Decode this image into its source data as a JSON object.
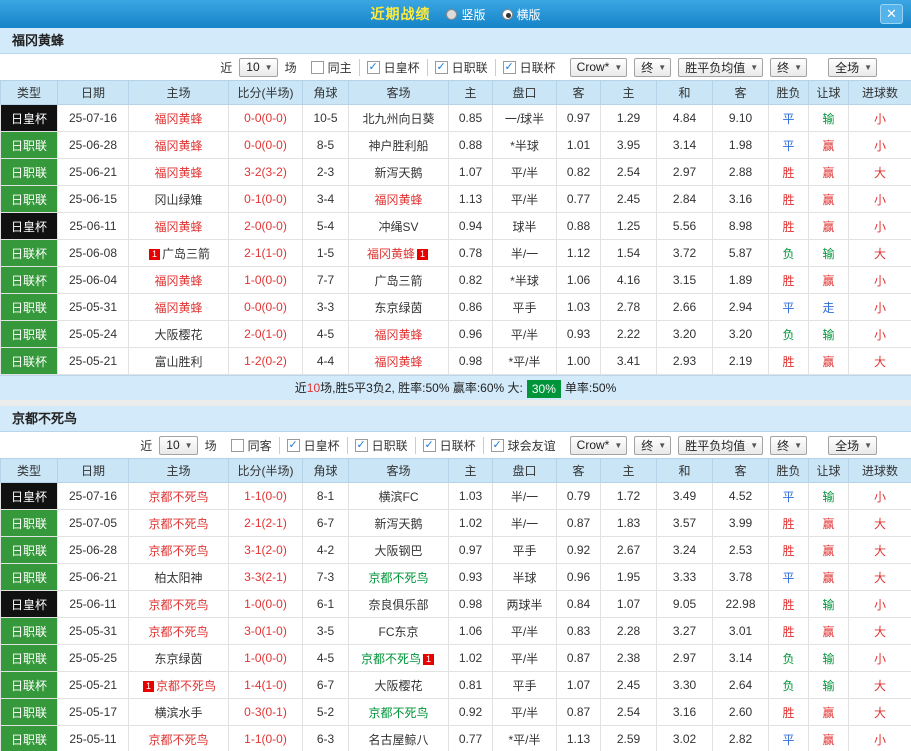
{
  "titlebar": {
    "title": "近期战绩",
    "layout_vertical": "竖版",
    "layout_horizontal": "横版",
    "close_icon": "✕"
  },
  "controls": {
    "near": "近",
    "count": "10",
    "unit": "场",
    "book": "Crow*",
    "final_a": "终",
    "avg": "胜平负均值",
    "final_b": "终",
    "scope": "全场"
  },
  "columns": [
    "类型",
    "日期",
    "主场",
    "比分(半场)",
    "角球",
    "客场",
    "主",
    "盘口",
    "客",
    "主",
    "和",
    "客",
    "胜负",
    "让球",
    "进球数"
  ],
  "colors": {
    "title_yellow": "#ffeb3b",
    "titlebar_blue": "#2196d3",
    "section_light_blue": "#d2eafa",
    "win_red": "#e03433",
    "draw_blue": "#2e6dd9",
    "lose_green": "#00953a",
    "emperor_cup_black": "#111111",
    "league_green": "#35983a",
    "red_card_badge": "#e60000",
    "over_rate_badge_green": "#00953a"
  },
  "sections": [
    {
      "team": "福冈黄蜂",
      "filters": [
        {
          "label": "同主",
          "checked": false
        },
        {
          "label": "日皇杯",
          "checked": true
        },
        {
          "label": "日职联",
          "checked": true
        },
        {
          "label": "日联杯",
          "checked": true
        }
      ],
      "rows": [
        {
          "t": "日皇杯",
          "tcls": "tk",
          "d": "25-07-16",
          "h": "福冈黄蜂",
          "hcls": "c-r",
          "hb": 0,
          "s": "0-0(0-0)",
          "cn": "10-5",
          "a": "北九州向日葵",
          "acls": "",
          "ab": 0,
          "w1": "0.85",
          "hd": "一/球半",
          "w2": "0.97",
          "e1": "1.29",
          "e2": "4.84",
          "e3": "9.10",
          "r": "平",
          "rc": "c-b",
          "l": "输",
          "lc": "c-g",
          "g": "小",
          "gc": "c-r"
        },
        {
          "t": "日职联",
          "tcls": "tg",
          "d": "25-06-28",
          "h": "福冈黄蜂",
          "hcls": "c-r",
          "hb": 0,
          "s": "0-0(0-0)",
          "cn": "8-5",
          "a": "神户胜利船",
          "acls": "",
          "ab": 0,
          "w1": "0.88",
          "hd": "*半球",
          "w2": "1.01",
          "e1": "3.95",
          "e2": "3.14",
          "e3": "1.98",
          "r": "平",
          "rc": "c-b",
          "l": "赢",
          "lc": "c-r",
          "g": "小",
          "gc": "c-r"
        },
        {
          "t": "日职联",
          "tcls": "tg",
          "d": "25-06-21",
          "h": "福冈黄蜂",
          "hcls": "c-r",
          "hb": 0,
          "s": "3-2(3-2)",
          "cn": "2-3",
          "a": "新泻天鹅",
          "acls": "",
          "ab": 0,
          "w1": "1.07",
          "hd": "平/半",
          "w2": "0.82",
          "e1": "2.54",
          "e2": "2.97",
          "e3": "2.88",
          "r": "胜",
          "rc": "c-r",
          "l": "赢",
          "lc": "c-r",
          "g": "大",
          "gc": "c-r"
        },
        {
          "t": "日职联",
          "tcls": "tg",
          "d": "25-06-15",
          "h": "冈山绿雉",
          "hcls": "",
          "hb": 0,
          "s": "0-1(0-0)",
          "cn": "3-4",
          "a": "福冈黄蜂",
          "acls": "c-r",
          "ab": 0,
          "w1": "1.13",
          "hd": "平/半",
          "w2": "0.77",
          "e1": "2.45",
          "e2": "2.84",
          "e3": "3.16",
          "r": "胜",
          "rc": "c-r",
          "l": "赢",
          "lc": "c-r",
          "g": "小",
          "gc": "c-r"
        },
        {
          "t": "日皇杯",
          "tcls": "tk",
          "d": "25-06-11",
          "h": "福冈黄蜂",
          "hcls": "c-r",
          "hb": 0,
          "s": "2-0(0-0)",
          "cn": "5-4",
          "a": "冲绳SV",
          "acls": "",
          "ab": 0,
          "w1": "0.94",
          "hd": "球半",
          "w2": "0.88",
          "e1": "1.25",
          "e2": "5.56",
          "e3": "8.98",
          "r": "胜",
          "rc": "c-r",
          "l": "赢",
          "lc": "c-r",
          "g": "小",
          "gc": "c-r"
        },
        {
          "t": "日联杯",
          "tcls": "tg",
          "d": "25-06-08",
          "h": "广岛三箭",
          "hcls": "",
          "hb": 1,
          "s": "2-1(1-0)",
          "cn": "1-5",
          "a": "福冈黄蜂",
          "acls": "c-r",
          "ab": 1,
          "w1": "0.78",
          "hd": "半/一",
          "w2": "1.12",
          "e1": "1.54",
          "e2": "3.72",
          "e3": "5.87",
          "r": "负",
          "rc": "c-g",
          "l": "输",
          "lc": "c-g",
          "g": "大",
          "gc": "c-r"
        },
        {
          "t": "日联杯",
          "tcls": "tg",
          "d": "25-06-04",
          "h": "福冈黄蜂",
          "hcls": "c-r",
          "hb": 0,
          "s": "1-0(0-0)",
          "cn": "7-7",
          "a": "广岛三箭",
          "acls": "",
          "ab": 0,
          "w1": "0.82",
          "hd": "*半球",
          "w2": "1.06",
          "e1": "4.16",
          "e2": "3.15",
          "e3": "1.89",
          "r": "胜",
          "rc": "c-r",
          "l": "赢",
          "lc": "c-r",
          "g": "小",
          "gc": "c-r"
        },
        {
          "t": "日职联",
          "tcls": "tg",
          "d": "25-05-31",
          "h": "福冈黄蜂",
          "hcls": "c-r",
          "hb": 0,
          "s": "0-0(0-0)",
          "cn": "3-3",
          "a": "东京绿茵",
          "acls": "",
          "ab": 0,
          "w1": "0.86",
          "hd": "平手",
          "w2": "1.03",
          "e1": "2.78",
          "e2": "2.66",
          "e3": "2.94",
          "r": "平",
          "rc": "c-b",
          "l": "走",
          "lc": "c-b",
          "g": "小",
          "gc": "c-r"
        },
        {
          "t": "日职联",
          "tcls": "tg",
          "d": "25-05-24",
          "h": "大阪樱花",
          "hcls": "",
          "hb": 0,
          "s": "2-0(1-0)",
          "cn": "4-5",
          "a": "福冈黄蜂",
          "acls": "c-r",
          "ab": 0,
          "w1": "0.96",
          "hd": "平/半",
          "w2": "0.93",
          "e1": "2.22",
          "e2": "3.20",
          "e3": "3.20",
          "r": "负",
          "rc": "c-g",
          "l": "输",
          "lc": "c-g",
          "g": "小",
          "gc": "c-r"
        },
        {
          "t": "日联杯",
          "tcls": "tg",
          "d": "25-05-21",
          "h": "富山胜利",
          "hcls": "",
          "hb": 0,
          "s": "1-2(0-2)",
          "cn": "4-4",
          "a": "福冈黄蜂",
          "acls": "c-r",
          "ab": 0,
          "w1": "0.98",
          "hd": "*平/半",
          "w2": "1.00",
          "e1": "3.41",
          "e2": "2.93",
          "e3": "2.19",
          "r": "胜",
          "rc": "c-r",
          "l": "赢",
          "lc": "c-r",
          "g": "大",
          "gc": "c-r"
        }
      ],
      "summary": {
        "prefix": "近",
        "count": "10",
        "mid": "场,胜5平3负2, 胜率:50% 赢率:60% 大:",
        "highlight": "30%",
        "suffix": "单率:50%"
      }
    },
    {
      "team": "京都不死鸟",
      "filters": [
        {
          "label": "同客",
          "checked": false
        },
        {
          "label": "日皇杯",
          "checked": true
        },
        {
          "label": "日职联",
          "checked": true
        },
        {
          "label": "日联杯",
          "checked": true
        },
        {
          "label": "球会友谊",
          "checked": true
        }
      ],
      "rows": [
        {
          "t": "日皇杯",
          "tcls": "tk",
          "d": "25-07-16",
          "h": "京都不死鸟",
          "hcls": "c-r",
          "hb": 0,
          "s": "1-1(0-0)",
          "cn": "8-1",
          "a": "横滨FC",
          "acls": "",
          "ab": 0,
          "w1": "1.03",
          "hd": "半/一",
          "w2": "0.79",
          "e1": "1.72",
          "e2": "3.49",
          "e3": "4.52",
          "r": "平",
          "rc": "c-b",
          "l": "输",
          "lc": "c-g",
          "g": "小",
          "gc": "c-r"
        },
        {
          "t": "日职联",
          "tcls": "tg",
          "d": "25-07-05",
          "h": "京都不死鸟",
          "hcls": "c-r",
          "hb": 0,
          "s": "2-1(2-1)",
          "cn": "6-7",
          "a": "新泻天鹅",
          "acls": "",
          "ab": 0,
          "w1": "1.02",
          "hd": "半/一",
          "w2": "0.87",
          "e1": "1.83",
          "e2": "3.57",
          "e3": "3.99",
          "r": "胜",
          "rc": "c-r",
          "l": "赢",
          "lc": "c-r",
          "g": "大",
          "gc": "c-r"
        },
        {
          "t": "日职联",
          "tcls": "tg",
          "d": "25-06-28",
          "h": "京都不死鸟",
          "hcls": "c-r",
          "hb": 0,
          "s": "3-1(2-0)",
          "cn": "4-2",
          "a": "大阪钢巴",
          "acls": "",
          "ab": 0,
          "w1": "0.97",
          "hd": "平手",
          "w2": "0.92",
          "e1": "2.67",
          "e2": "3.24",
          "e3": "2.53",
          "r": "胜",
          "rc": "c-r",
          "l": "赢",
          "lc": "c-r",
          "g": "大",
          "gc": "c-r"
        },
        {
          "t": "日职联",
          "tcls": "tg",
          "d": "25-06-21",
          "h": "柏太阳神",
          "hcls": "",
          "hb": 0,
          "s": "3-3(2-1)",
          "cn": "7-3",
          "a": "京都不死鸟",
          "acls": "c-g",
          "ab": 0,
          "w1": "0.93",
          "hd": "半球",
          "w2": "0.96",
          "e1": "1.95",
          "e2": "3.33",
          "e3": "3.78",
          "r": "平",
          "rc": "c-b",
          "l": "赢",
          "lc": "c-r",
          "g": "大",
          "gc": "c-r"
        },
        {
          "t": "日皇杯",
          "tcls": "tk",
          "d": "25-06-11",
          "h": "京都不死鸟",
          "hcls": "c-r",
          "hb": 0,
          "s": "1-0(0-0)",
          "cn": "6-1",
          "a": "奈良俱乐部",
          "acls": "",
          "ab": 0,
          "w1": "0.98",
          "hd": "两球半",
          "w2": "0.84",
          "e1": "1.07",
          "e2": "9.05",
          "e3": "22.98",
          "r": "胜",
          "rc": "c-r",
          "l": "输",
          "lc": "c-g",
          "g": "小",
          "gc": "c-r"
        },
        {
          "t": "日职联",
          "tcls": "tg",
          "d": "25-05-31",
          "h": "京都不死鸟",
          "hcls": "c-r",
          "hb": 0,
          "s": "3-0(1-0)",
          "cn": "3-5",
          "a": "FC东京",
          "acls": "",
          "ab": 0,
          "w1": "1.06",
          "hd": "平/半",
          "w2": "0.83",
          "e1": "2.28",
          "e2": "3.27",
          "e3": "3.01",
          "r": "胜",
          "rc": "c-r",
          "l": "赢",
          "lc": "c-r",
          "g": "大",
          "gc": "c-r"
        },
        {
          "t": "日职联",
          "tcls": "tg",
          "d": "25-05-25",
          "h": "东京绿茵",
          "hcls": "",
          "hb": 0,
          "s": "1-0(0-0)",
          "cn": "4-5",
          "a": "京都不死鸟",
          "acls": "c-g",
          "ab": 1,
          "w1": "1.02",
          "hd": "平/半",
          "w2": "0.87",
          "e1": "2.38",
          "e2": "2.97",
          "e3": "3.14",
          "r": "负",
          "rc": "c-g",
          "l": "输",
          "lc": "c-g",
          "g": "小",
          "gc": "c-r"
        },
        {
          "t": "日联杯",
          "tcls": "tg",
          "d": "25-05-21",
          "h": "京都不死鸟",
          "hcls": "c-r",
          "hb": 1,
          "s": "1-4(1-0)",
          "cn": "6-7",
          "a": "大阪樱花",
          "acls": "",
          "ab": 0,
          "w1": "0.81",
          "hd": "平手",
          "w2": "1.07",
          "e1": "2.45",
          "e2": "3.30",
          "e3": "2.64",
          "r": "负",
          "rc": "c-g",
          "l": "输",
          "lc": "c-g",
          "g": "大",
          "gc": "c-r"
        },
        {
          "t": "日职联",
          "tcls": "tg",
          "d": "25-05-17",
          "h": "横滨水手",
          "hcls": "",
          "hb": 0,
          "s": "0-3(0-1)",
          "cn": "5-2",
          "a": "京都不死鸟",
          "acls": "c-g",
          "ab": 0,
          "w1": "0.92",
          "hd": "平/半",
          "w2": "0.87",
          "e1": "2.54",
          "e2": "3.16",
          "e3": "2.60",
          "r": "胜",
          "rc": "c-r",
          "l": "赢",
          "lc": "c-r",
          "g": "大",
          "gc": "c-r"
        },
        {
          "t": "日职联",
          "tcls": "tg",
          "d": "25-05-11",
          "h": "京都不死鸟",
          "hcls": "c-r",
          "hb": 0,
          "s": "1-1(0-0)",
          "cn": "6-3",
          "a": "名古屋鲸八",
          "acls": "",
          "ab": 0,
          "w1": "0.77",
          "hd": "*平/半",
          "w2": "1.13",
          "e1": "2.59",
          "e2": "3.02",
          "e3": "2.82",
          "r": "平",
          "rc": "c-b",
          "l": "赢",
          "lc": "c-r",
          "g": "小",
          "gc": "c-r"
        }
      ]
    }
  ]
}
